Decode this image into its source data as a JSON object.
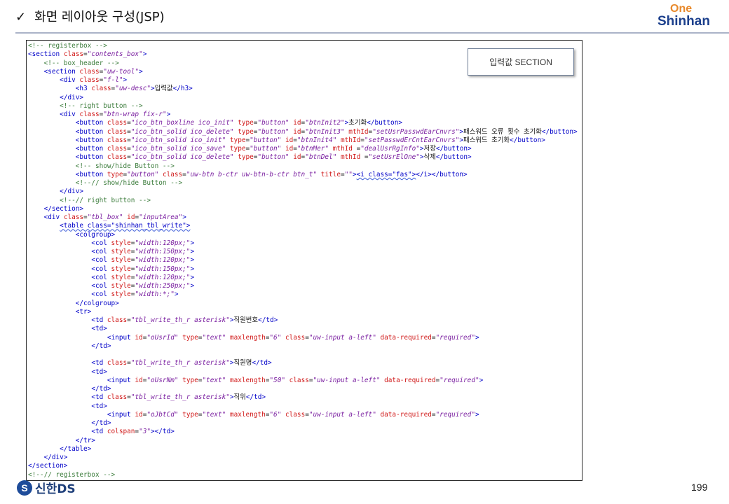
{
  "header": {
    "check_mark": "✓",
    "title": "화면 레이아웃 구성(JSP)",
    "logo_top": "One",
    "logo_bottom": "Shinhan"
  },
  "badge": {
    "label": "입력값 SECTION"
  },
  "code_lines": [
    [
      [
        "c",
        "<!-- registerbox -->"
      ]
    ],
    [
      [
        "t",
        "<section "
      ],
      [
        "a",
        "class"
      ],
      [
        "k",
        "="
      ],
      [
        "v",
        "\"contents_box\""
      ],
      [
        "t",
        ">"
      ]
    ],
    [
      [
        "k",
        "    "
      ],
      [
        "c",
        "<!-- box_header -->"
      ]
    ],
    [
      [
        "k",
        "    "
      ],
      [
        "t",
        "<section "
      ],
      [
        "a",
        "class"
      ],
      [
        "k",
        "="
      ],
      [
        "v",
        "\"uw-tool\""
      ],
      [
        "t",
        ">"
      ]
    ],
    [
      [
        "k",
        "        "
      ],
      [
        "t",
        "<div "
      ],
      [
        "a",
        "class"
      ],
      [
        "k",
        "="
      ],
      [
        "v",
        "\"f-l\""
      ],
      [
        "t",
        ">"
      ]
    ],
    [
      [
        "k",
        "            "
      ],
      [
        "t",
        "<h3 "
      ],
      [
        "a",
        "class"
      ],
      [
        "k",
        "="
      ],
      [
        "v",
        "\"uw-desc\""
      ],
      [
        "t",
        ">"
      ],
      [
        "k",
        "입력값"
      ],
      [
        "t",
        "</h3>"
      ]
    ],
    [
      [
        "k",
        "        "
      ],
      [
        "t",
        "</div>"
      ]
    ],
    [
      [
        "k",
        "        "
      ],
      [
        "c",
        "<!-- right button -->"
      ]
    ],
    [
      [
        "k",
        "        "
      ],
      [
        "t",
        "<div "
      ],
      [
        "a",
        "class"
      ],
      [
        "k",
        "="
      ],
      [
        "v",
        "\"btn-wrap fix-r\""
      ],
      [
        "t",
        ">"
      ]
    ],
    [
      [
        "k",
        "            "
      ],
      [
        "t",
        "<button "
      ],
      [
        "a",
        "class"
      ],
      [
        "k",
        "="
      ],
      [
        "v",
        "\"ico_btn_boxline ico_init\""
      ],
      [
        "k",
        " "
      ],
      [
        "a",
        "type"
      ],
      [
        "k",
        "="
      ],
      [
        "v",
        "\"button\""
      ],
      [
        "k",
        " "
      ],
      [
        "a",
        "id"
      ],
      [
        "k",
        "="
      ],
      [
        "v",
        "\"btnInit2\""
      ],
      [
        "t",
        ">"
      ],
      [
        "k",
        "초기화"
      ],
      [
        "t",
        "</button>"
      ]
    ],
    [
      [
        "k",
        "            "
      ],
      [
        "t",
        "<button "
      ],
      [
        "a",
        "class"
      ],
      [
        "k",
        "="
      ],
      [
        "v",
        "\"ico_btn_solid ico_delete\""
      ],
      [
        "k",
        " "
      ],
      [
        "a",
        "type"
      ],
      [
        "k",
        "="
      ],
      [
        "v",
        "\"button\""
      ],
      [
        "k",
        " "
      ],
      [
        "a",
        "id"
      ],
      [
        "k",
        "="
      ],
      [
        "v",
        "\"btnInit3\""
      ],
      [
        "k",
        " "
      ],
      [
        "a",
        "mthId"
      ],
      [
        "k",
        "="
      ],
      [
        "v",
        "\"setUsrPasswdEarCnvrs\""
      ],
      [
        "t",
        ">"
      ],
      [
        "k",
        "패스워드 오류 횟수 초기화"
      ],
      [
        "t",
        "</button>"
      ]
    ],
    [
      [
        "k",
        "            "
      ],
      [
        "t",
        "<button "
      ],
      [
        "a",
        "class"
      ],
      [
        "k",
        "="
      ],
      [
        "v",
        "\"ico_btn_solid ico_init\""
      ],
      [
        "k",
        " "
      ],
      [
        "a",
        "type"
      ],
      [
        "k",
        "="
      ],
      [
        "v",
        "\"button\""
      ],
      [
        "k",
        " "
      ],
      [
        "a",
        "id"
      ],
      [
        "k",
        "="
      ],
      [
        "v",
        "\"btnInit4\""
      ],
      [
        "k",
        " "
      ],
      [
        "a",
        "mthId"
      ],
      [
        "k",
        "="
      ],
      [
        "v",
        "\"setPasswdErCntEarCnvrs\""
      ],
      [
        "t",
        ">"
      ],
      [
        "k",
        "패스워드 초기화"
      ],
      [
        "t",
        "</button>"
      ]
    ],
    [
      [
        "k",
        "            "
      ],
      [
        "t",
        "<button "
      ],
      [
        "a",
        "class"
      ],
      [
        "k",
        "="
      ],
      [
        "v",
        "\"ico_btn_solid ico_save\""
      ],
      [
        "k",
        " "
      ],
      [
        "a",
        "type"
      ],
      [
        "k",
        "="
      ],
      [
        "v",
        "\"button\""
      ],
      [
        "k",
        " "
      ],
      [
        "a",
        "id"
      ],
      [
        "k",
        "="
      ],
      [
        "v",
        "\"btnMer\""
      ],
      [
        "k",
        " "
      ],
      [
        "a",
        "mthId"
      ],
      [
        "k",
        " ="
      ],
      [
        "v",
        "\"dealUsrRgInfo\""
      ],
      [
        "t",
        ">"
      ],
      [
        "k",
        "저장"
      ],
      [
        "t",
        "</button>"
      ]
    ],
    [
      [
        "k",
        "            "
      ],
      [
        "t",
        "<button "
      ],
      [
        "a",
        "class"
      ],
      [
        "k",
        "="
      ],
      [
        "v",
        "\"ico_btn_solid ico_delete\""
      ],
      [
        "k",
        " "
      ],
      [
        "a",
        "type"
      ],
      [
        "k",
        "="
      ],
      [
        "v",
        "\"button\""
      ],
      [
        "k",
        " "
      ],
      [
        "a",
        "id"
      ],
      [
        "k",
        "="
      ],
      [
        "v",
        "\"btnDel\""
      ],
      [
        "k",
        " "
      ],
      [
        "a",
        "mthId"
      ],
      [
        "k",
        " ="
      ],
      [
        "v",
        "\"setUsrElOne\""
      ],
      [
        "t",
        ">"
      ],
      [
        "k",
        "삭제"
      ],
      [
        "t",
        "</button>"
      ]
    ],
    [
      [
        "k",
        "            "
      ],
      [
        "c",
        "<!-- show/hide Button -->"
      ]
    ],
    [
      [
        "k",
        "            "
      ],
      [
        "t",
        "<button "
      ],
      [
        "a",
        "type"
      ],
      [
        "k",
        "="
      ],
      [
        "v",
        "\"button\""
      ],
      [
        "k",
        " "
      ],
      [
        "a",
        "class"
      ],
      [
        "k",
        "="
      ],
      [
        "v",
        "\"uw-btn b-ctr uw-btn-b-ctr btn_t\""
      ],
      [
        "k",
        " "
      ],
      [
        "a",
        "title"
      ],
      [
        "k",
        "="
      ],
      [
        "v",
        "\"\""
      ],
      [
        "t",
        ">"
      ],
      [
        "q",
        "<i class=\"fas\">"
      ],
      [
        "t",
        "</i></button>"
      ]
    ],
    [
      [
        "k",
        "            "
      ],
      [
        "c",
        "<!--// show/hide Button -->"
      ]
    ],
    [
      [
        "k",
        "        "
      ],
      [
        "t",
        "</div>"
      ]
    ],
    [
      [
        "k",
        "        "
      ],
      [
        "c",
        "<!--// right button -->"
      ]
    ],
    [
      [
        "k",
        "    "
      ],
      [
        "t",
        "</section>"
      ]
    ],
    [
      [
        "k",
        "    "
      ],
      [
        "t",
        "<div "
      ],
      [
        "a",
        "class"
      ],
      [
        "k",
        "="
      ],
      [
        "v",
        "\"tbl_box\""
      ],
      [
        "k",
        " "
      ],
      [
        "a",
        "id"
      ],
      [
        "k",
        "="
      ],
      [
        "v",
        "\"inputArea\""
      ],
      [
        "t",
        ">"
      ]
    ],
    [
      [
        "k",
        "        "
      ],
      [
        "q",
        "<table class=\"shinhan_tbl_write\">"
      ]
    ],
    [
      [
        "k",
        "            "
      ],
      [
        "t",
        "<colgroup>"
      ]
    ],
    [
      [
        "k",
        "                "
      ],
      [
        "t",
        "<col "
      ],
      [
        "a",
        "style"
      ],
      [
        "k",
        "="
      ],
      [
        "v",
        "\"width:120px;\""
      ],
      [
        "t",
        ">"
      ]
    ],
    [
      [
        "k",
        "                "
      ],
      [
        "t",
        "<col "
      ],
      [
        "a",
        "style"
      ],
      [
        "k",
        "="
      ],
      [
        "v",
        "\"width:150px;\""
      ],
      [
        "t",
        ">"
      ]
    ],
    [
      [
        "k",
        "                "
      ],
      [
        "t",
        "<col "
      ],
      [
        "a",
        "style"
      ],
      [
        "k",
        "="
      ],
      [
        "v",
        "\"width:120px;\""
      ],
      [
        "t",
        ">"
      ]
    ],
    [
      [
        "k",
        "                "
      ],
      [
        "t",
        "<col "
      ],
      [
        "a",
        "style"
      ],
      [
        "k",
        "="
      ],
      [
        "v",
        "\"width:150px;\""
      ],
      [
        "t",
        ">"
      ]
    ],
    [
      [
        "k",
        "                "
      ],
      [
        "t",
        "<col "
      ],
      [
        "a",
        "style"
      ],
      [
        "k",
        "="
      ],
      [
        "v",
        "\"width:120px;\""
      ],
      [
        "t",
        ">"
      ]
    ],
    [
      [
        "k",
        "                "
      ],
      [
        "t",
        "<col "
      ],
      [
        "a",
        "style"
      ],
      [
        "k",
        "="
      ],
      [
        "v",
        "\"width:250px;\""
      ],
      [
        "t",
        ">"
      ]
    ],
    [
      [
        "k",
        "                "
      ],
      [
        "t",
        "<col "
      ],
      [
        "a",
        "style"
      ],
      [
        "k",
        "="
      ],
      [
        "v",
        "\"width:*;\""
      ],
      [
        "t",
        ">"
      ]
    ],
    [
      [
        "k",
        "            "
      ],
      [
        "t",
        "</colgroup>"
      ]
    ],
    [
      [
        "k",
        "            "
      ],
      [
        "t",
        "<tr>"
      ]
    ],
    [
      [
        "k",
        "                "
      ],
      [
        "t",
        "<td "
      ],
      [
        "a",
        "class"
      ],
      [
        "k",
        "="
      ],
      [
        "v",
        "\"tbl_write_th_r asterisk\""
      ],
      [
        "t",
        ">"
      ],
      [
        "k",
        "직원번호"
      ],
      [
        "t",
        "</td>"
      ]
    ],
    [
      [
        "k",
        "                "
      ],
      [
        "t",
        "<td>"
      ]
    ],
    [
      [
        "k",
        "                    "
      ],
      [
        "t",
        "<input "
      ],
      [
        "a",
        "id"
      ],
      [
        "k",
        "="
      ],
      [
        "v",
        "\"oUsrId\""
      ],
      [
        "k",
        " "
      ],
      [
        "a",
        "type"
      ],
      [
        "k",
        "="
      ],
      [
        "v",
        "\"text\""
      ],
      [
        "k",
        " "
      ],
      [
        "a",
        "maxlength"
      ],
      [
        "k",
        "="
      ],
      [
        "v",
        "\"6\""
      ],
      [
        "k",
        " "
      ],
      [
        "a",
        "class"
      ],
      [
        "k",
        "="
      ],
      [
        "v",
        "\"uw-input a-left\""
      ],
      [
        "k",
        " "
      ],
      [
        "a",
        "data-required"
      ],
      [
        "k",
        "="
      ],
      [
        "v",
        "\"required\""
      ],
      [
        "t",
        ">"
      ]
    ],
    [
      [
        "k",
        "                "
      ],
      [
        "t",
        "</td>"
      ]
    ],
    [
      [
        "k",
        ""
      ]
    ],
    [
      [
        "k",
        "                "
      ],
      [
        "t",
        "<td "
      ],
      [
        "a",
        "class"
      ],
      [
        "k",
        "="
      ],
      [
        "v",
        "\"tbl_write_th_r asterisk\""
      ],
      [
        "t",
        ">"
      ],
      [
        "k",
        "직원명"
      ],
      [
        "t",
        "</td>"
      ]
    ],
    [
      [
        "k",
        "                "
      ],
      [
        "t",
        "<td>"
      ]
    ],
    [
      [
        "k",
        "                    "
      ],
      [
        "t",
        "<input "
      ],
      [
        "a",
        "id"
      ],
      [
        "k",
        "="
      ],
      [
        "v",
        "\"oUsrNm\""
      ],
      [
        "k",
        " "
      ],
      [
        "a",
        "type"
      ],
      [
        "k",
        "="
      ],
      [
        "v",
        "\"text\""
      ],
      [
        "k",
        " "
      ],
      [
        "a",
        "maxlength"
      ],
      [
        "k",
        "="
      ],
      [
        "v",
        "\"50\""
      ],
      [
        "k",
        " "
      ],
      [
        "a",
        "class"
      ],
      [
        "k",
        "="
      ],
      [
        "v",
        "\"uw-input a-left\""
      ],
      [
        "k",
        " "
      ],
      [
        "a",
        "data-required"
      ],
      [
        "k",
        "="
      ],
      [
        "v",
        "\"required\""
      ],
      [
        "t",
        ">"
      ]
    ],
    [
      [
        "k",
        "                "
      ],
      [
        "t",
        "</td>"
      ]
    ],
    [
      [
        "k",
        "                "
      ],
      [
        "t",
        "<td "
      ],
      [
        "a",
        "class"
      ],
      [
        "k",
        "="
      ],
      [
        "v",
        "\"tbl_write_th_r asterisk\""
      ],
      [
        "t",
        ">"
      ],
      [
        "k",
        "직위"
      ],
      [
        "t",
        "</td>"
      ]
    ],
    [
      [
        "k",
        "                "
      ],
      [
        "t",
        "<td>"
      ]
    ],
    [
      [
        "k",
        "                    "
      ],
      [
        "t",
        "<input "
      ],
      [
        "a",
        "id"
      ],
      [
        "k",
        "="
      ],
      [
        "v",
        "\"oJbtCd\""
      ],
      [
        "k",
        " "
      ],
      [
        "a",
        "type"
      ],
      [
        "k",
        "="
      ],
      [
        "v",
        "\"text\""
      ],
      [
        "k",
        " "
      ],
      [
        "a",
        "maxlength"
      ],
      [
        "k",
        "="
      ],
      [
        "v",
        "\"6\""
      ],
      [
        "k",
        " "
      ],
      [
        "a",
        "class"
      ],
      [
        "k",
        "="
      ],
      [
        "v",
        "\"uw-input a-left\""
      ],
      [
        "k",
        " "
      ],
      [
        "a",
        "data-required"
      ],
      [
        "k",
        "="
      ],
      [
        "v",
        "\"required\""
      ],
      [
        "t",
        ">"
      ]
    ],
    [
      [
        "k",
        "                "
      ],
      [
        "t",
        "</td>"
      ]
    ],
    [
      [
        "k",
        "                "
      ],
      [
        "t",
        "<td "
      ],
      [
        "a",
        "colspan"
      ],
      [
        "k",
        "="
      ],
      [
        "v",
        "\"3\""
      ],
      [
        "t",
        "></td>"
      ]
    ],
    [
      [
        "k",
        "            "
      ],
      [
        "t",
        "</tr>"
      ]
    ],
    [
      [
        "k",
        "        "
      ],
      [
        "t",
        "</table>"
      ]
    ],
    [
      [
        "k",
        "    "
      ],
      [
        "t",
        "</div>"
      ]
    ],
    [
      [
        "t",
        "</section>"
      ]
    ],
    [
      [
        "c",
        "<!--// registerbox -->"
      ]
    ]
  ],
  "footer": {
    "logo_mark": "S",
    "logo_name": "신한DS",
    "page_number": "199"
  }
}
